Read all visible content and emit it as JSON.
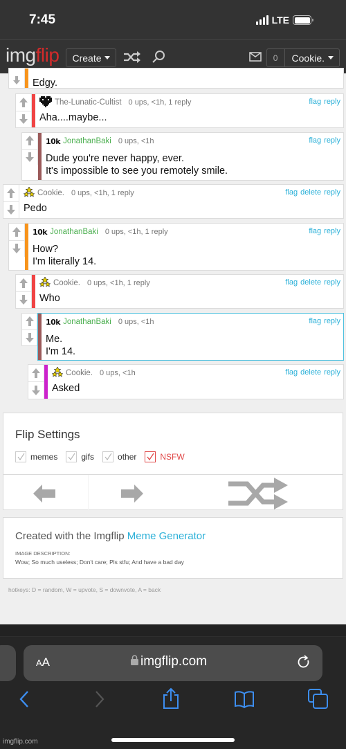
{
  "status_bar": {
    "time": "7:45",
    "network": "LTE",
    "battery_level": 1.0
  },
  "header": {
    "logo_img": "img",
    "logo_flip": "flip",
    "create_label": "Create",
    "notification_count": "0",
    "username": "Cookie.",
    "icons": [
      "shuffle-icon",
      "search-icon",
      "mail-icon"
    ]
  },
  "comments": [
    {
      "id": "c0",
      "username": "",
      "points": "",
      "stats": "",
      "text": "Edgy.",
      "actions": [],
      "bar_color": "#f7941d",
      "partial": true
    },
    {
      "id": "c1",
      "username": "The-Lunatic-Cultist",
      "points": "",
      "stats": "0 ups, <1h, 1 reply",
      "text": "Aha....maybe...",
      "actions": [
        "flag",
        "reply"
      ],
      "bar_color": "#f04444",
      "avatar": "pixel-heart-icon"
    },
    {
      "id": "c2",
      "username": "JonathanBaki",
      "points": "10k",
      "stats": "0 ups, <1h",
      "text": "Dude you're never happy, ever.\nIt's impossible to see you remotely smile.",
      "actions": [
        "flag",
        "reply"
      ],
      "bar_color": "#9b5a5a"
    },
    {
      "id": "c3",
      "username": "Cookie.",
      "points": "",
      "stats": "0 ups, <1h, 1 reply",
      "text": "Pedo",
      "actions": [
        "flag",
        "delete",
        "reply"
      ],
      "bar_color": "",
      "avatar": "stars-icon"
    },
    {
      "id": "c4",
      "username": "JonathanBaki",
      "points": "10k",
      "stats": "0 ups, <1h, 1 reply",
      "text": "How?\nI'm literally 14.",
      "actions": [
        "flag",
        "reply"
      ],
      "bar_color": "#f7941d"
    },
    {
      "id": "c5",
      "username": "Cookie.",
      "points": "",
      "stats": "0 ups, <1h, 1 reply",
      "text": "Who",
      "actions": [
        "flag",
        "delete",
        "reply"
      ],
      "bar_color": "#f04444",
      "avatar": "stars-icon"
    },
    {
      "id": "c6",
      "username": "JonathanBaki",
      "points": "10k",
      "stats": "0 ups, <1h",
      "text": "Me.\nI'm 14.",
      "actions": [
        "flag",
        "reply"
      ],
      "bar_color": "#9b5a5a",
      "highlighted": true
    },
    {
      "id": "c7",
      "username": "Cookie.",
      "points": "",
      "stats": "0 ups, <1h",
      "text": "Asked",
      "actions": [
        "flag",
        "delete",
        "reply"
      ],
      "bar_color": "#cc22cc",
      "avatar": "stars-icon"
    }
  ],
  "flip_settings": {
    "title": "Flip Settings",
    "options": [
      {
        "label": "memes",
        "checked": true
      },
      {
        "label": "gifs",
        "checked": true
      },
      {
        "label": "other",
        "checked": true
      },
      {
        "label": "NSFW",
        "checked": true,
        "accent": "#e04848"
      }
    ]
  },
  "created": {
    "prefix": "Created with the Imgflip",
    "link": "Meme Generator",
    "desc_label": "IMAGE DESCRIPTION:",
    "desc_text": "Wow; So much useless; Don't care; Pls stfu; And have a bad day"
  },
  "hotkeys": "hotkeys: D = random, W = upvote, S = downvote, A = back",
  "safari": {
    "aa_small": "A",
    "aa_large": "A",
    "url": "imgflip.com"
  },
  "watermark": "imgflip.com",
  "colors": {
    "link": "#2bb0d8",
    "username_green": "#4caf50",
    "logo_red": "#d22b2b"
  }
}
